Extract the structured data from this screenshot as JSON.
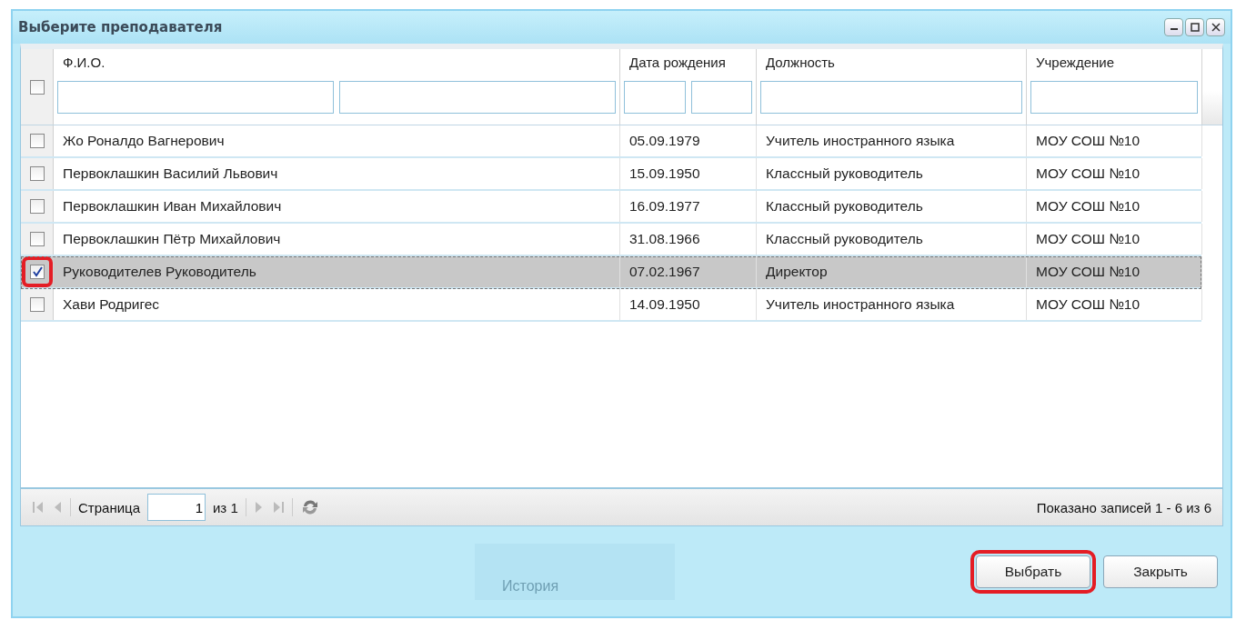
{
  "window": {
    "title": "Выберите преподавателя"
  },
  "table": {
    "select_all": {
      "checked": false
    },
    "columns": [
      {
        "label": "Ф.И.О.",
        "filters": [
          {
            "kind": "text"
          },
          {
            "kind": "text"
          }
        ]
      },
      {
        "label": "Дата рождения",
        "filters": [
          {
            "kind": "text"
          },
          {
            "kind": "text"
          }
        ]
      },
      {
        "label": "Должность",
        "filters": [
          {
            "kind": "text"
          }
        ]
      },
      {
        "label": "Учреждение",
        "filters": [
          {
            "kind": "text"
          }
        ]
      }
    ],
    "rows": [
      {
        "cells": [
          "Жо Роналдо Вагнерович",
          "05.09.1979",
          "Учитель иностранного языка",
          "МОУ СОШ №10"
        ],
        "checked": false,
        "selected": false,
        "highlighted": false
      },
      {
        "cells": [
          "Первоклашкин Василий Львович",
          "15.09.1950",
          "Классный руководитель",
          "МОУ СОШ №10"
        ],
        "checked": false,
        "selected": false,
        "highlighted": false
      },
      {
        "cells": [
          "Первоклашкин Иван Михайлович",
          "16.09.1977",
          "Классный руководитель",
          "МОУ СОШ №10"
        ],
        "checked": false,
        "selected": false,
        "highlighted": false
      },
      {
        "cells": [
          "Первоклашкин Пётр Михайлович",
          "31.08.1966",
          "Классный руководитель",
          "МОУ СОШ №10"
        ],
        "checked": false,
        "selected": false,
        "highlighted": false
      },
      {
        "cells": [
          "Руководителев Руководитель",
          "07.02.1967",
          "Директор",
          "МОУ СОШ №10"
        ],
        "checked": true,
        "selected": true,
        "highlighted": true
      },
      {
        "cells": [
          "Хави Родригес",
          "14.09.1950",
          "Учитель иностранного языка",
          "МОУ СОШ №10"
        ],
        "checked": false,
        "selected": false,
        "highlighted": false
      }
    ]
  },
  "pager": {
    "page_label": "Страница",
    "page_value": "1",
    "of_label": "из 1",
    "summary": "Показано записей 1 - 6 из 6"
  },
  "background": {
    "menu_item": "История"
  },
  "buttons": [
    {
      "label": "Выбрать",
      "highlighted": true
    },
    {
      "label": "Закрыть",
      "highlighted": false
    }
  ]
}
